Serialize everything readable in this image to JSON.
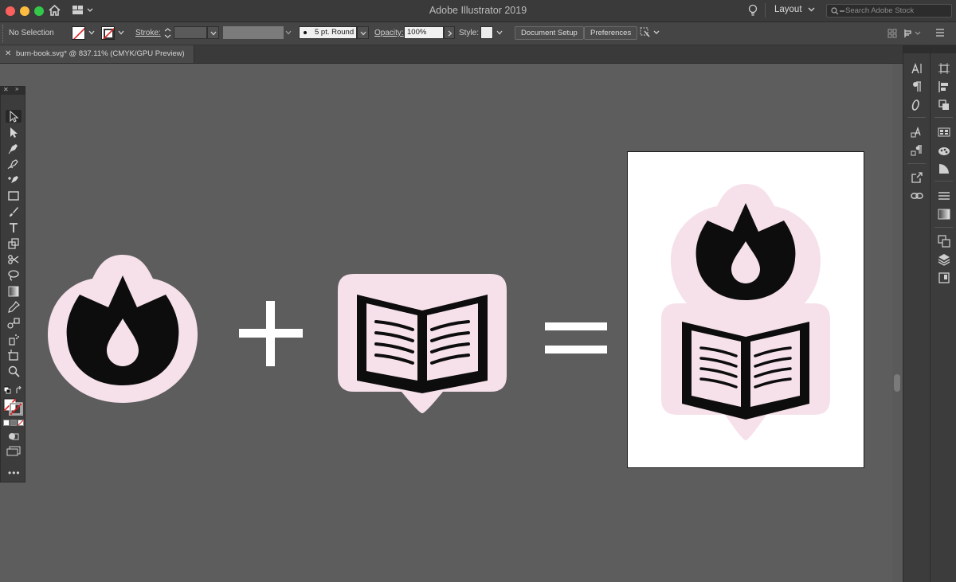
{
  "window": {
    "title": "Adobe Illustrator 2019",
    "workspace_label": "Layout",
    "search_placeholder": "Search Adobe Stock"
  },
  "control_bar": {
    "selection_label": "No Selection",
    "stroke_label": "Stroke:",
    "brush_label": "5 pt. Round",
    "opacity_label": "Opacity:",
    "opacity_value": "100%",
    "style_label": "Style:",
    "document_setup_label": "Document Setup",
    "preferences_label": "Preferences"
  },
  "document_tab": {
    "title": "burn-book.svg* @ 837.11% (CMYK/GPU Preview)"
  },
  "tools": [
    "selection-tool",
    "direct-selection-tool",
    "pen-tool",
    "curvature-tool",
    "anchor-point-tool",
    "rectangle-tool",
    "paintbrush-tool",
    "type-tool",
    "scale-tool",
    "scissors-tool",
    "lasso-tool",
    "gradient-tool",
    "eyedropper-tool",
    "blend-tool",
    "symbol-sprayer-tool",
    "artboard-tool",
    "zoom-tool"
  ],
  "canvas": {
    "plus_symbol": "+",
    "equals_symbol": "=",
    "sticker_color": "#f6e1ea",
    "icon_color": "#0d0d0d"
  }
}
